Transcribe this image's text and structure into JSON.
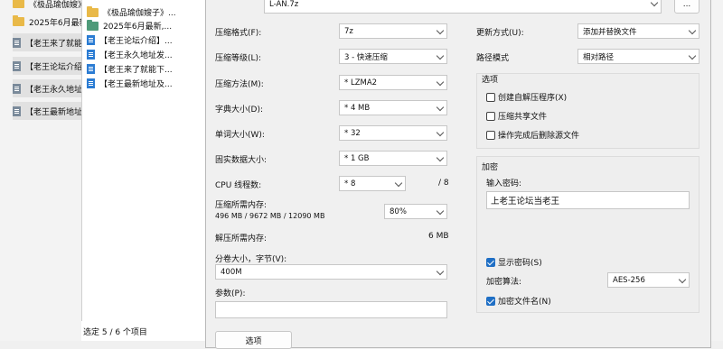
{
  "explorer": {
    "rows": [
      {
        "label": "《极品瑜伽嫂》",
        "icon": "folder"
      },
      {
        "label": "2025年6月最新",
        "icon": "folder"
      },
      {
        "label": "【老王来了就能",
        "icon": "doc"
      },
      {
        "label": "【老王论坛介绍",
        "icon": "doc"
      },
      {
        "label": "【老王永久地址",
        "icon": "doc"
      },
      {
        "label": "【老王最新地址",
        "icon": "doc"
      }
    ],
    "side_items": [
      {
        "label": "《极品瑜伽嫂子》...",
        "icon": "folder"
      },
      {
        "label": "2025年6月最新,...",
        "icon": "folder-green"
      },
      {
        "label": "【老王论坛介绍】...",
        "icon": "doc"
      },
      {
        "label": "【老王永久地址发...",
        "icon": "doc"
      },
      {
        "label": "【老王来了就能下...",
        "icon": "doc"
      },
      {
        "label": "【老王最新地址及...",
        "icon": "doc"
      }
    ],
    "status": "选定 5 / 6 个项目"
  },
  "dialog": {
    "archive_name": "L-AN.7z",
    "browse_label": "...",
    "format_label": "压缩格式(F):",
    "format_value": "7z",
    "level_label": "压缩等级(L):",
    "level_value": "3 - 快速压缩",
    "method_label": "压缩方法(M):",
    "method_value": "* LZMA2",
    "dict_label": "字典大小(D):",
    "dict_value": "* 4 MB",
    "word_label": "单词大小(W):",
    "word_value": "* 32",
    "solid_label": "固实数据大小:",
    "solid_value": "* 1 GB",
    "cpu_label": "CPU 线程数:",
    "cpu_value": "* 8",
    "cpu_max": "/ 8",
    "mem_label": "压缩所需内存:",
    "mem_detail": "496 MB / 9672 MB / 12090 MB",
    "mem_value": "80%",
    "decomp_label": "解压所需内存:",
    "decomp_value": "6 MB",
    "volume_label": "分卷大小，字节(V):",
    "volume_value": "400M",
    "params_label": "参数(P):",
    "params_value": "",
    "options_button": "选项",
    "update_label": "更新方式(U):",
    "update_value": "添加并替换文件",
    "path_label": "路径模式",
    "path_value": "相对路径",
    "options_group": "选项",
    "opt_sfx": "创建自解压程序(X)",
    "opt_shared": "压缩共享文件",
    "opt_delete": "操作完成后删除源文件",
    "encrypt_group": "加密",
    "password_label": "输入密码:",
    "password_value": "上老王论坛当老王",
    "show_password": "显示密码(S)",
    "enc_method_label": "加密算法:",
    "enc_method_value": "AES-256",
    "enc_names": "加密文件名(N)"
  },
  "colors": {
    "accent": "#1f6fc5",
    "folder": "#e9b948"
  }
}
